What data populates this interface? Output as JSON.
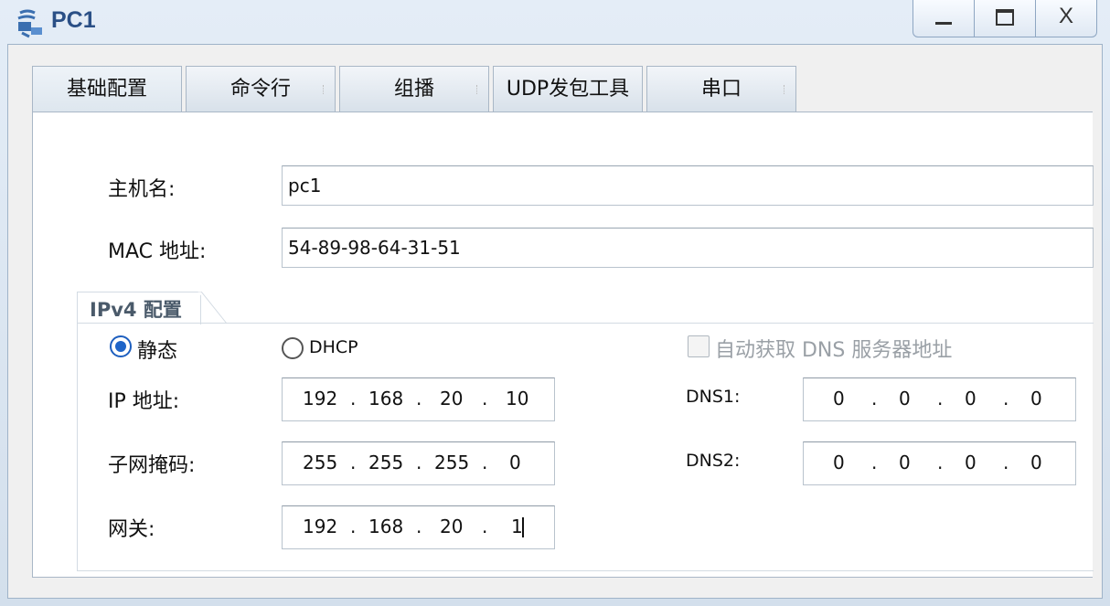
{
  "window": {
    "title": "PC1"
  },
  "tabs": [
    "基础配置",
    "命令行",
    "组播",
    "UDP发包工具",
    "串口"
  ],
  "basic": {
    "hostname_label": "主机名:",
    "hostname_value": "pc1",
    "mac_label": "MAC 地址:",
    "mac_value": "54-89-98-64-31-51"
  },
  "ipv4": {
    "group_title": "IPv4 配置",
    "static_label": "静态",
    "dhcp_label": "DHCP",
    "auto_dns_label": "自动获取 DNS 服务器地址",
    "mode": "static",
    "ip_label": "IP 地址:",
    "ip": [
      "192",
      "168",
      "20",
      "10"
    ],
    "mask_label": "子网掩码:",
    "mask": [
      "255",
      "255",
      "255",
      "0"
    ],
    "gateway_label": "网关:",
    "gateway": [
      "192",
      "168",
      "20",
      "1"
    ],
    "dns1_label": "DNS1:",
    "dns1": [
      "0",
      "0",
      "0",
      "0"
    ],
    "dns2_label": "DNS2:",
    "dns2": [
      "0",
      "0",
      "0",
      "0"
    ]
  },
  "colors": {
    "accent": "#1e64c8",
    "title": "#2a4f86"
  },
  "icons": {
    "app": "network-pc-icon"
  }
}
